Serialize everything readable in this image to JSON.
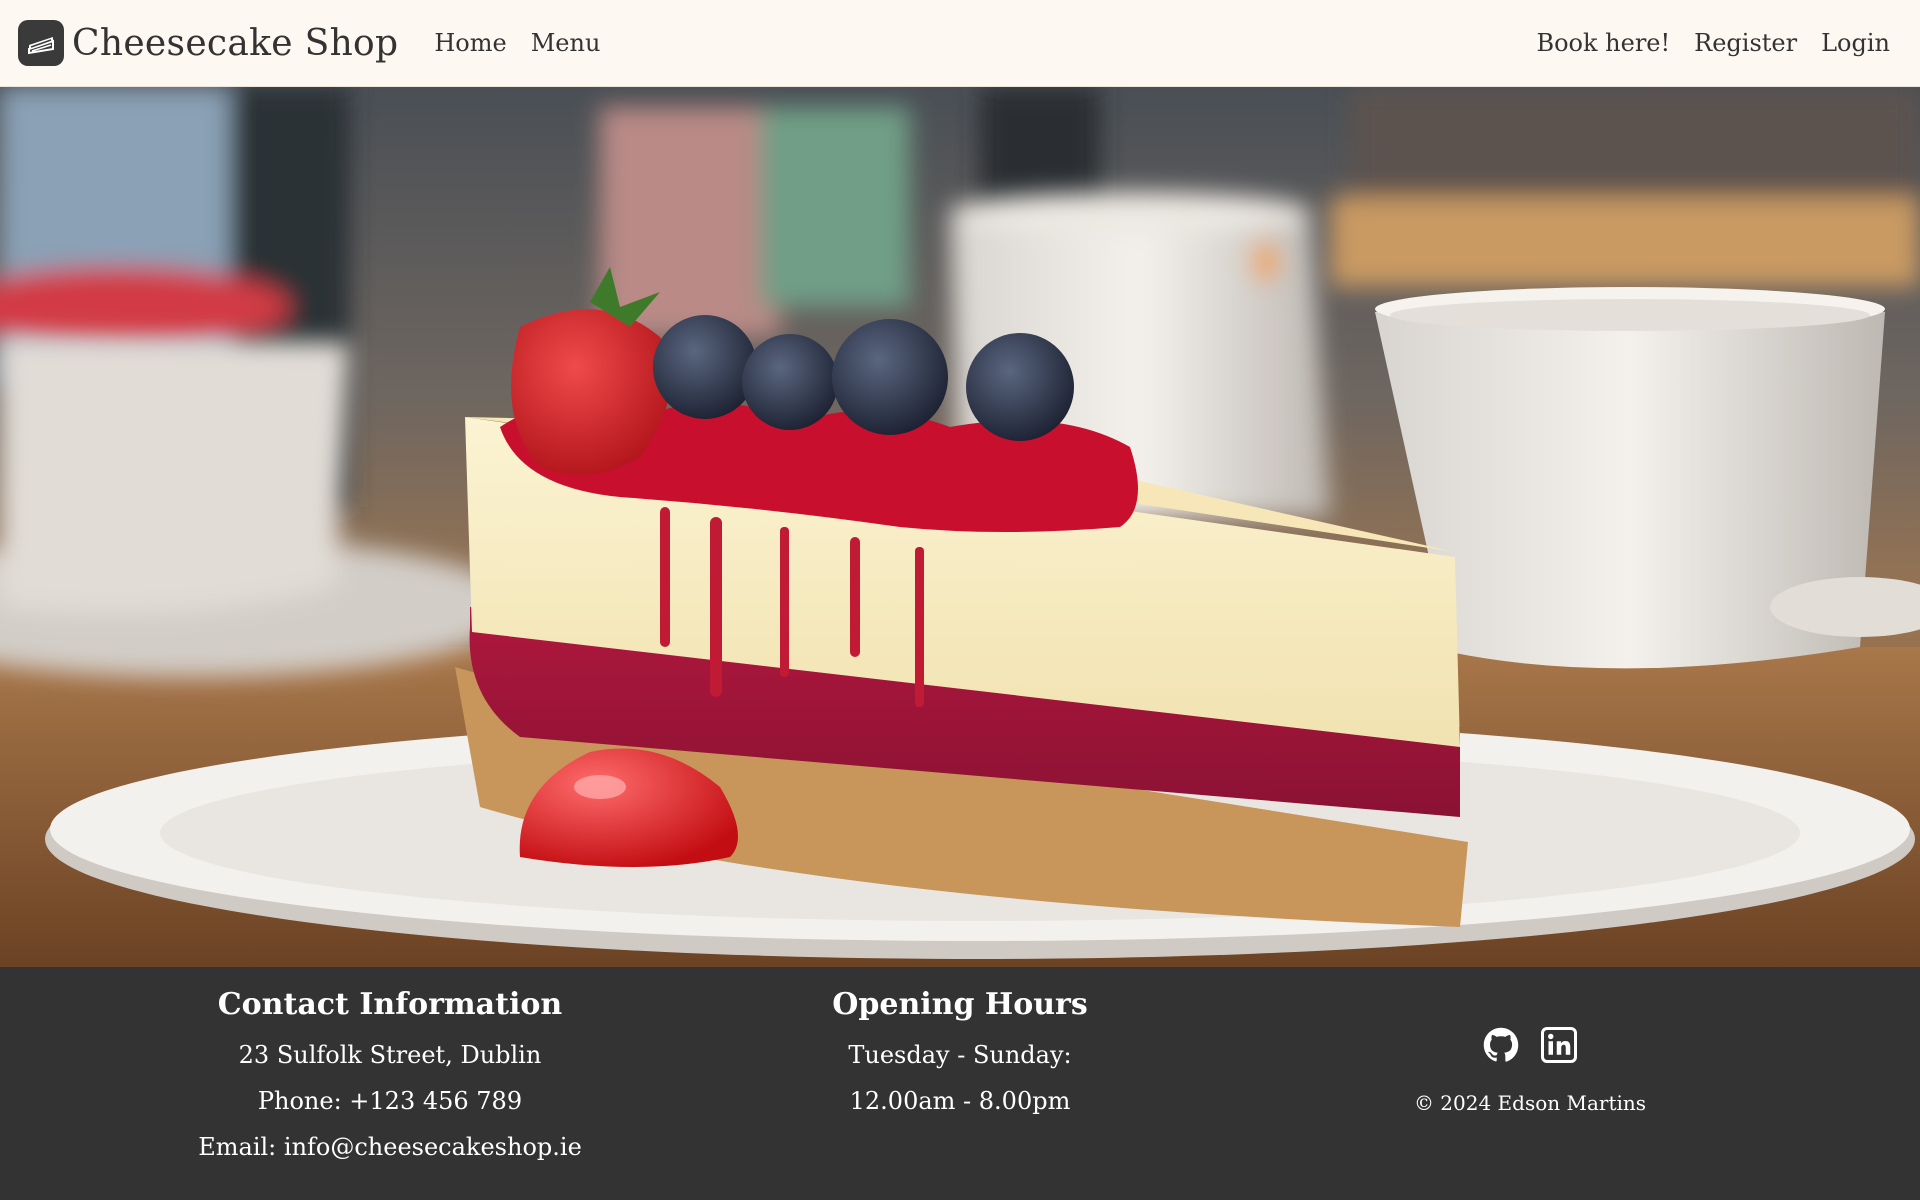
{
  "navbar": {
    "brand": "Cheesecake Shop",
    "brand_icon": "cake-slice-icon",
    "left_links": [
      "Home",
      "Menu"
    ],
    "right_links": [
      "Book here!",
      "Register",
      "Login"
    ]
  },
  "footer": {
    "contact": {
      "title": "Contact Information",
      "address": "23 Sulfolk Street, Dublin",
      "phone": "Phone: +123 456 789",
      "email": "Email: info@cheesecakeshop.ie"
    },
    "hours": {
      "title": "Opening Hours",
      "days": "Tuesday - Sunday:",
      "times": "12.00am - 8.00pm"
    },
    "social": {
      "icons": [
        "github-icon",
        "linkedin-icon"
      ],
      "copyright": "© 2024 Edson Martins"
    }
  },
  "colors": {
    "navbar_bg": "#fdf8f2",
    "footer_bg": "#333333",
    "text_dark": "#333333",
    "text_light": "#ffffff"
  }
}
